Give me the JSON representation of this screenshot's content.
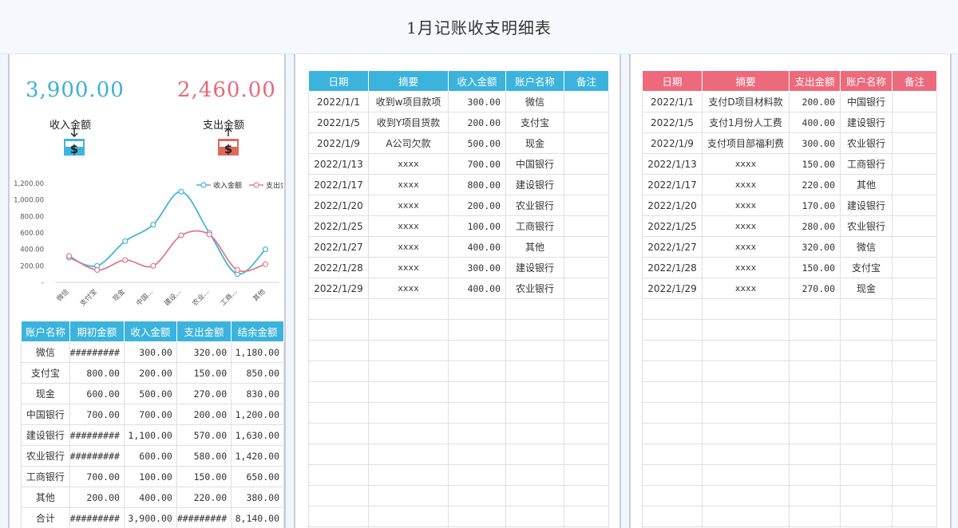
{
  "title": "1月记账收支明细表",
  "summary": {
    "income_amount": "3,900.00",
    "expense_amount": "2,460.00",
    "income_label": "收入金额",
    "expense_label": "支出金额",
    "income_color": "#3bb0d8",
    "expense_color": "#e8697a",
    "icons": [
      "money-in-icon",
      "money-out-icon"
    ]
  },
  "chart_data": {
    "type": "line",
    "categories": [
      "微信",
      "支付宝",
      "现金",
      "中国...",
      "建设...",
      "农业...",
      "工商...",
      "其他"
    ],
    "series": [
      {
        "name": "收入金额",
        "values": [
          300,
          200,
          500,
          700,
          1100,
          600,
          100,
          400
        ],
        "color": "#46b4d6"
      },
      {
        "name": "支出金",
        "values": [
          320,
          150,
          270,
          200,
          570,
          580,
          150,
          220
        ],
        "color": "#e27a8b"
      }
    ],
    "ytick_labels": [
      "-",
      "200.00",
      "400.00",
      "600.00",
      "800.00",
      "1,000.00",
      "1,200.00"
    ],
    "ylim": [
      0,
      1200
    ],
    "legend_position": "top-right",
    "smooth": true
  },
  "account_summary": {
    "headers": [
      "账户名称",
      "期初金额",
      "收入金额",
      "支出金额",
      "结余金额"
    ],
    "rows": [
      [
        "微信",
        "#########",
        "300.00",
        "320.00",
        "1,180.00"
      ],
      [
        "支付宝",
        "800.00",
        "200.00",
        "150.00",
        "850.00"
      ],
      [
        "现金",
        "600.00",
        "500.00",
        "270.00",
        "830.00"
      ],
      [
        "中国银行",
        "700.00",
        "700.00",
        "200.00",
        "1,200.00"
      ],
      [
        "建设银行",
        "#########",
        "1,100.00",
        "570.00",
        "1,630.00"
      ],
      [
        "农业银行",
        "#########",
        "600.00",
        "580.00",
        "1,420.00"
      ],
      [
        "工商银行",
        "700.00",
        "100.00",
        "150.00",
        "650.00"
      ],
      [
        "其他",
        "200.00",
        "400.00",
        "220.00",
        "380.00"
      ],
      [
        "合计",
        "#########",
        "3,900.00",
        "#########",
        "8,140.00"
      ]
    ]
  },
  "income_ledger": {
    "headers": [
      "日期",
      "摘要",
      "收入金额",
      "账户名称",
      "备注"
    ],
    "rows": [
      [
        "2022/1/1",
        "收到w项目款项",
        "300.00",
        "微信",
        ""
      ],
      [
        "2022/1/5",
        "收到Y项目货款",
        "200.00",
        "支付宝",
        ""
      ],
      [
        "2022/1/9",
        "A公司欠款",
        "500.00",
        "现金",
        ""
      ],
      [
        "2022/1/13",
        "xxxx",
        "700.00",
        "中国银行",
        ""
      ],
      [
        "2022/1/17",
        "xxxx",
        "800.00",
        "建设银行",
        ""
      ],
      [
        "2022/1/20",
        "xxxx",
        "200.00",
        "农业银行",
        ""
      ],
      [
        "2022/1/25",
        "xxxx",
        "100.00",
        "工商银行",
        ""
      ],
      [
        "2022/1/27",
        "xxxx",
        "400.00",
        "其他",
        ""
      ],
      [
        "2022/1/28",
        "xxxx",
        "300.00",
        "建设银行",
        ""
      ],
      [
        "2022/1/29",
        "xxxx",
        "400.00",
        "农业银行",
        ""
      ]
    ]
  },
  "expense_ledger": {
    "headers": [
      "日期",
      "摘要",
      "支出金额",
      "账户名称",
      "备注"
    ],
    "rows": [
      [
        "2022/1/1",
        "支付D项目材料款",
        "200.00",
        "中国银行",
        ""
      ],
      [
        "2022/1/5",
        "支付1月份人工费",
        "400.00",
        "建设银行",
        ""
      ],
      [
        "2022/1/9",
        "支付项目部福利费",
        "300.00",
        "农业银行",
        ""
      ],
      [
        "2022/1/13",
        "xxxx",
        "150.00",
        "工商银行",
        ""
      ],
      [
        "2022/1/17",
        "xxxx",
        "220.00",
        "其他",
        ""
      ],
      [
        "2022/1/20",
        "xxxx",
        "170.00",
        "建设银行",
        ""
      ],
      [
        "2022/1/25",
        "xxxx",
        "280.00",
        "农业银行",
        ""
      ],
      [
        "2022/1/27",
        "xxxx",
        "320.00",
        "微信",
        ""
      ],
      [
        "2022/1/28",
        "xxxx",
        "150.00",
        "支付宝",
        ""
      ],
      [
        "2022/1/29",
        "xxxx",
        "270.00",
        "现金",
        ""
      ]
    ]
  }
}
